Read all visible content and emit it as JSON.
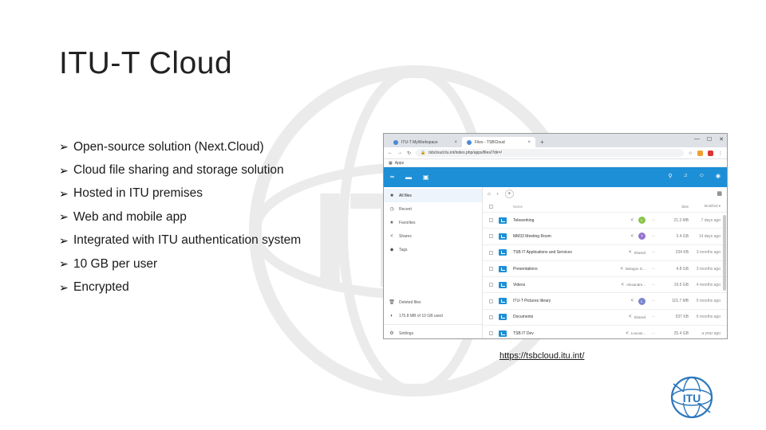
{
  "slide": {
    "title": "ITU-T Cloud",
    "bullets": [
      "Open-source solution (Next.Cloud)",
      "Cloud file sharing and storage solution",
      "Hosted in ITU premises",
      "Web and mobile app",
      "Integrated with ITU authentication system",
      "10 GB per user",
      "Encrypted"
    ],
    "link": "https://tsbcloud.itu.int/",
    "logo_text": "ITU"
  },
  "browser": {
    "tabs": [
      {
        "label": "ITU-T MyWorkspace"
      },
      {
        "label": "Files - TSBCloud"
      }
    ],
    "new_tab": "+",
    "window_controls": [
      "—",
      "☐",
      "✕"
    ],
    "url": "tsbcloud.itu.int/index.php/apps/files/?dir=/",
    "bookmarks_label": "Apps"
  },
  "app": {
    "header_icons": [
      "folder-icon",
      "image-icon",
      "search-icon",
      "bell-icon",
      "contacts-icon",
      "user-icon"
    ],
    "sidebar": [
      {
        "label": "All files",
        "icon": "■"
      },
      {
        "label": "Recent",
        "icon": "◷"
      },
      {
        "label": "Favorites",
        "icon": "★"
      },
      {
        "label": "Shares",
        "icon": "<"
      },
      {
        "label": "Tags",
        "icon": "◆"
      }
    ],
    "sidebar_bottom": [
      {
        "label": "Deleted files",
        "icon": "🗑"
      },
      {
        "label": "175.8 MB of 10 GB used",
        "icon": "◐"
      },
      {
        "label": "Settings",
        "icon": "⚙"
      }
    ],
    "columns": {
      "name": "Name",
      "size": "Size",
      "modified": "Modified"
    },
    "files": [
      {
        "name": "Teleworking",
        "shared": "",
        "avatar": "L",
        "avatar_color": "#8bc34a",
        "size": "21.3 MB",
        "modified": "7 days ago"
      },
      {
        "name": "MM33 Meeting Room",
        "shared": "",
        "avatar": "T",
        "avatar_color": "#9575cd",
        "size": "3.4 GB",
        "modified": "14 days ago"
      },
      {
        "name": "TSB IT Applications and Services",
        "shared": "Shared",
        "avatar": "",
        "avatar_color": "",
        "size": "234 KB",
        "modified": "3 months ago"
      },
      {
        "name": "Presentations",
        "shared": "Balogun G...",
        "avatar": "",
        "avatar_color": "",
        "size": "4.8 GB",
        "modified": "3 months ago"
      },
      {
        "name": "Videos",
        "shared": "Alexandre...",
        "avatar": "",
        "avatar_color": "",
        "size": "19.5 GB",
        "modified": "4 months ago"
      },
      {
        "name": "ITU-T Pictures library",
        "shared": "",
        "avatar": "L",
        "avatar_color": "#7986cb",
        "size": "115.7 MB",
        "modified": "5 months ago"
      },
      {
        "name": "Documents",
        "shared": "Shared",
        "avatar": "",
        "avatar_color": "",
        "size": "537 KB",
        "modified": "6 months ago"
      },
      {
        "name": "TSB IT Dev",
        "shared": "Loucas...",
        "avatar": "",
        "avatar_color": "",
        "size": "25.4 GB",
        "modified": "a year ago"
      }
    ]
  }
}
